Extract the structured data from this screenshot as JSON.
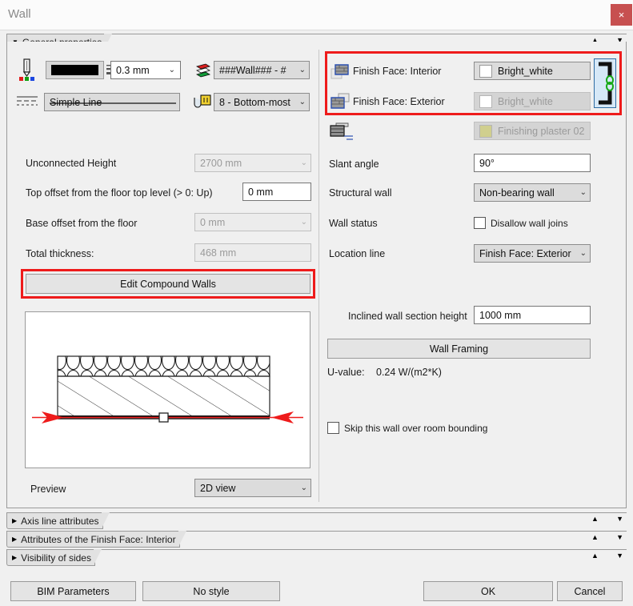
{
  "window": {
    "title": "Wall",
    "close_label": "×"
  },
  "sections": {
    "general": {
      "label": "General properties",
      "expanded": true
    },
    "collapsed": [
      {
        "label": "Axis line attributes"
      },
      {
        "label": "Attributes of the Finish Face: Interior"
      },
      {
        "label": "Visibility of sides"
      }
    ]
  },
  "attributes_row": {
    "pen_icon": "pen-color-icon",
    "line_weight": "0.3 mm",
    "layer_icon": "layers-icon",
    "layer": "###Wall### - #",
    "line_type_icon": "line-type-icon",
    "line_type": "Simple Line",
    "priority_icon": "intersection-priority-icon",
    "priority": "8 - Bottom-most"
  },
  "left": {
    "unconnected_height": {
      "label": "Unconnected Height",
      "value": "2700 mm",
      "disabled": true
    },
    "top_offset": {
      "label": "Top offset from the floor top level (> 0: Up)",
      "value": "0 mm"
    },
    "base_offset": {
      "label": "Base offset from the floor",
      "value": "0 mm",
      "disabled": true
    },
    "total_thickness": {
      "label": "Total thickness:",
      "value": "468 mm",
      "disabled": true
    },
    "edit_compound": {
      "label": "Edit Compound Walls",
      "highlighted": true
    },
    "preview": {
      "label": "Preview",
      "value": "2D view"
    }
  },
  "finish_faces": {
    "highlighted": true,
    "rows": [
      {
        "icon": "finish-face-interior-icon",
        "label": "Finish Face: Interior",
        "material": "Bright_white",
        "swatch": "#ffffff",
        "disabled": false
      },
      {
        "icon": "finish-face-exterior-icon",
        "label": "Finish Face: Exterior",
        "material": "Bright_white",
        "swatch": "#ffffff",
        "disabled": true
      }
    ],
    "link_icon": "link-faces-icon",
    "edge": {
      "icon": "wall-edge-icon",
      "material": "Finishing plaster 02",
      "swatch": "#d0cf8e",
      "disabled": true
    }
  },
  "right": {
    "slant_angle": {
      "label": "Slant angle",
      "value": "90°"
    },
    "structural_wall": {
      "label": "Structural wall",
      "value": "Non-bearing wall"
    },
    "wall_status": {
      "label": "Wall status",
      "checkbox_label": "Disallow wall joins",
      "checked": false
    },
    "location_line": {
      "label": "Location line",
      "value": "Finish Face: Exterior"
    },
    "inclined_height": {
      "label": "Inclined wall section height",
      "value": "1000 mm"
    },
    "wall_framing": {
      "label": "Wall Framing"
    },
    "u_value": {
      "label": "U-value:",
      "value": "0.24 W/(m2*K)"
    },
    "skip_room_bounding": {
      "label": "Skip this wall over room bounding",
      "checked": false
    }
  },
  "footer": {
    "bim_parameters": "BIM Parameters",
    "no_style": "No style",
    "ok": "OK",
    "cancel": "Cancel"
  },
  "colors": {
    "highlight_red": "#ee1b1b",
    "close_red": "#c75050",
    "panel_bg": "#f0f0f0",
    "link_active_bg": "#d6e8f7",
    "link_active_border": "#2e6da4"
  }
}
